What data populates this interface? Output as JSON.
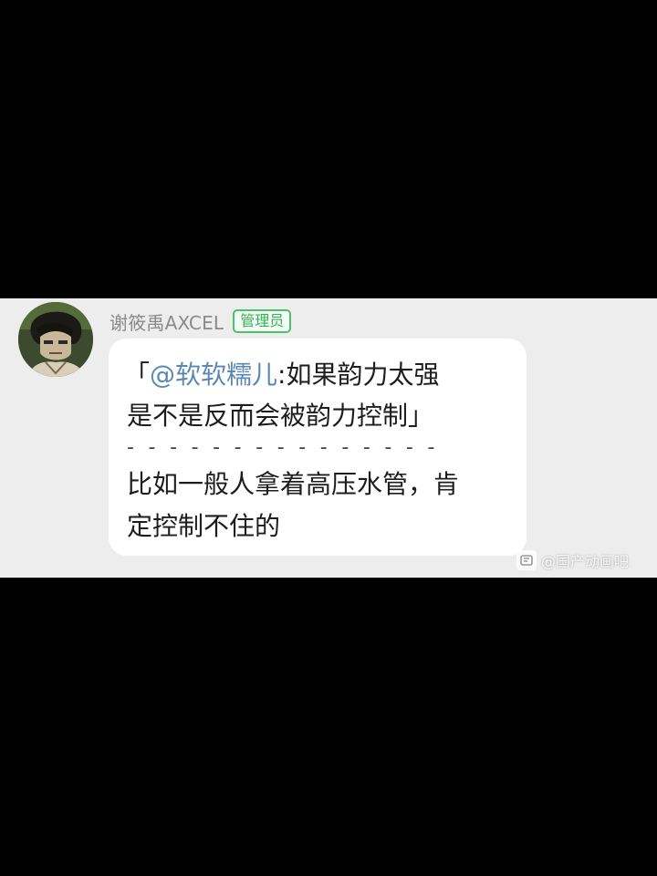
{
  "message": {
    "sender_name": "谢筱禹AXCEL",
    "role_badge": "管理员",
    "quote_open": "「",
    "quote_mention": "@软软糯儿",
    "quote_text_1": ":如果韵力太强",
    "quote_text_2": "是不是反而会被韵力控制」",
    "divider": "- - - - - - - - - - - - - - -",
    "reply_line_1": "比如一般人拿着高压水管，肯",
    "reply_line_2": "定控制不住的"
  },
  "watermark": {
    "text": "@国产动画吧",
    "icon": "tieba-logo-icon"
  },
  "colors": {
    "chat_background": "#ededed",
    "badge_green": "#36b156",
    "mention_blue": "#5b87b5"
  }
}
